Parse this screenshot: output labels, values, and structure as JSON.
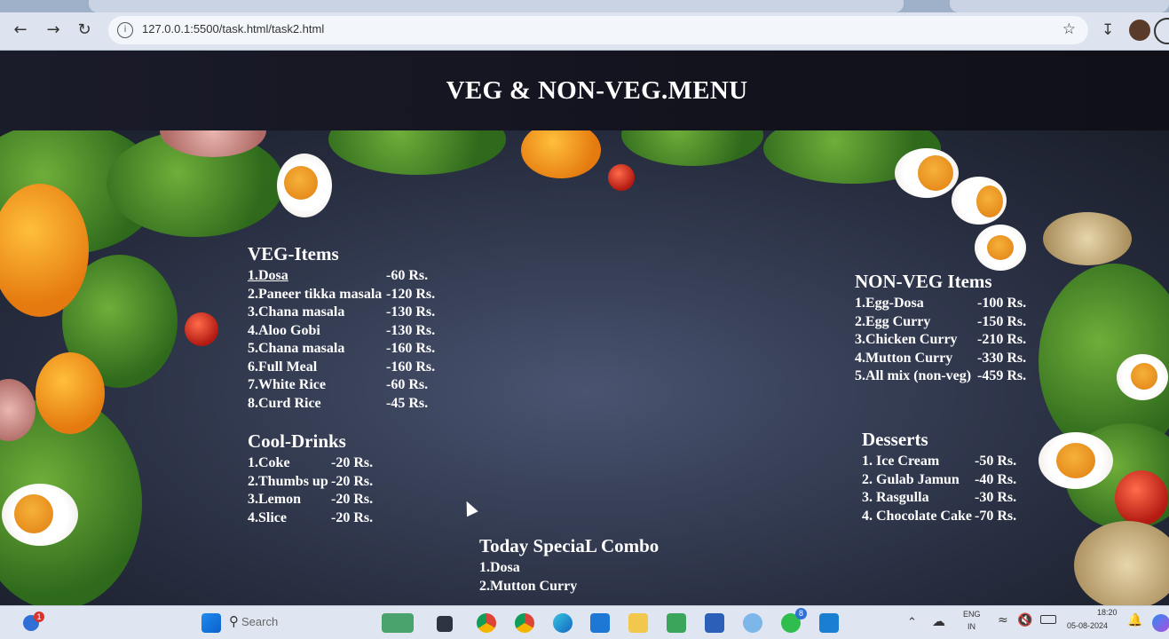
{
  "browser": {
    "url": "127.0.0.1:5500/task.html/task2.html",
    "back_icon": "arrow-left-icon",
    "forward_icon": "arrow-right-icon",
    "reload_icon": "reload-icon"
  },
  "page": {
    "title": "VEG & NON-VEG.MENU"
  },
  "veg": {
    "heading": "VEG-Items",
    "items": [
      {
        "name": "1.Dosa",
        "price": "-60 Rs."
      },
      {
        "name": "2.Paneer tikka masala",
        "price": "-120 Rs."
      },
      {
        "name": "3.Chana masala",
        "price": "-130 Rs."
      },
      {
        "name": "4.Aloo Gobi",
        "price": "-130 Rs."
      },
      {
        "name": "5.Chana masala",
        "price": "-160 Rs."
      },
      {
        "name": "6.Full Meal",
        "price": "-160 Rs."
      },
      {
        "name": "7.White Rice",
        "price": "-60 Rs."
      },
      {
        "name": "8.Curd Rice",
        "price": "-45 Rs."
      }
    ]
  },
  "drinks": {
    "heading": "Cool-Drinks",
    "items": [
      {
        "name": "1.Coke",
        "price": "-20 Rs."
      },
      {
        "name": "2.Thumbs up",
        "price": "-20 Rs."
      },
      {
        "name": "3.Lemon",
        "price": "-20 Rs."
      },
      {
        "name": "4.Slice",
        "price": "-20 Rs."
      }
    ]
  },
  "nonveg": {
    "heading": "NON-VEG Items",
    "items": [
      {
        "name": "1.Egg-Dosa",
        "price": "-100 Rs."
      },
      {
        "name": "2.Egg Curry",
        "price": "-150 Rs."
      },
      {
        "name": "3.Chicken Curry",
        "price": "-210 Rs."
      },
      {
        "name": "4.Mutton Curry",
        "price": "-330 Rs."
      },
      {
        "name": "5.All mix (non-veg)",
        "price": "-459 Rs."
      }
    ]
  },
  "desserts": {
    "heading": "Desserts",
    "items": [
      {
        "name": "1. Ice Cream",
        "price": "-50 Rs."
      },
      {
        "name": "2. Gulab Jamun",
        "price": "-40 Rs."
      },
      {
        "name": "3. Rasgulla",
        "price": "-30 Rs."
      },
      {
        "name": "4. Chocolate Cake",
        "price": "-70 Rs."
      }
    ]
  },
  "special": {
    "heading": "Today SpeciaL Combo",
    "items": [
      "1.Dosa",
      "2.Mutton Curry"
    ]
  },
  "taskbar": {
    "search_placeholder": "Search",
    "notification_count": "1",
    "whatsapp_badge": "8",
    "language": "ENG",
    "region": "IN",
    "time": "18:20",
    "date": "05-08-2024"
  },
  "colors": {
    "header_bg": "#13131e",
    "board_bg": "#363e55",
    "text": "#ffffff"
  }
}
